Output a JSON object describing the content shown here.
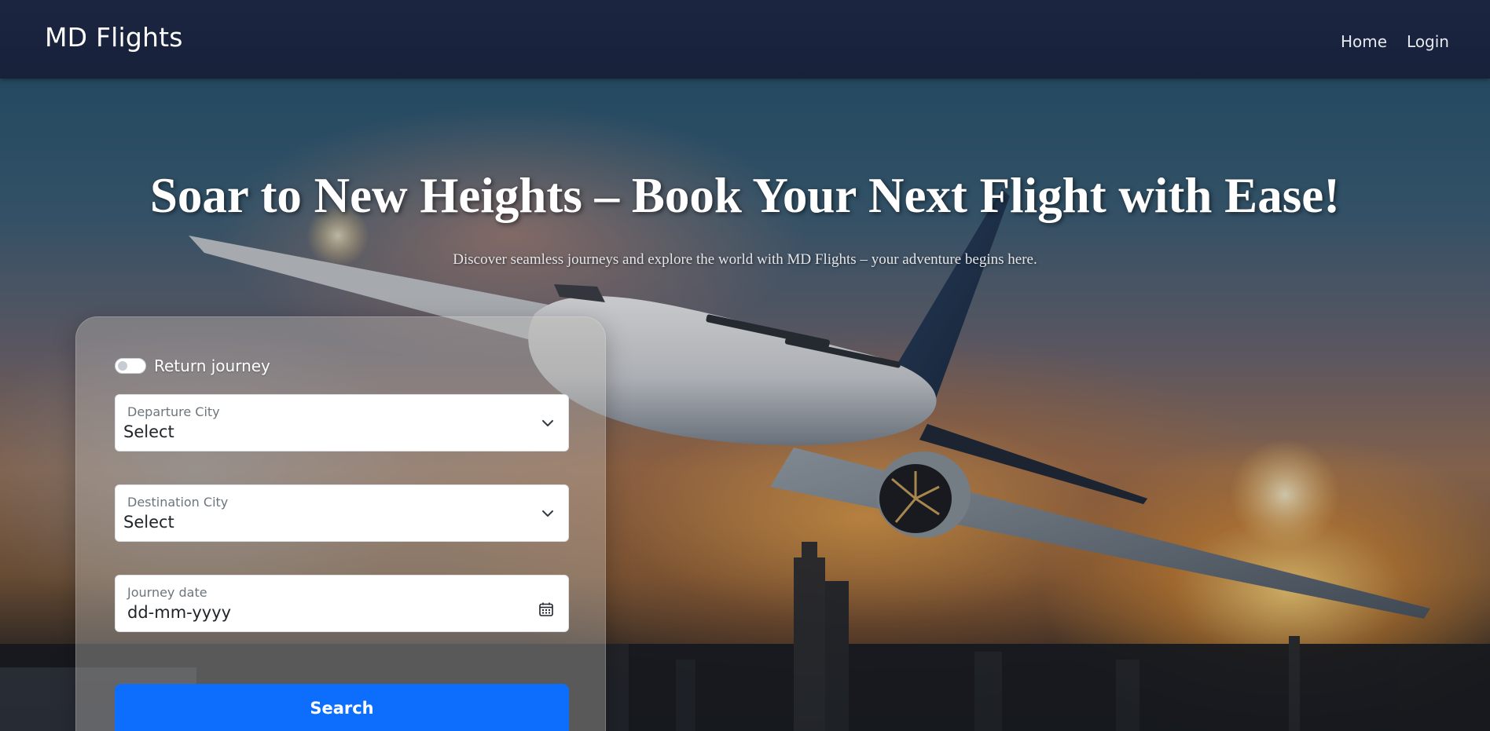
{
  "navbar": {
    "brand": "MD Flights",
    "links": [
      "Home",
      "Login"
    ]
  },
  "hero": {
    "title": "Soar to New Heights – Book Your Next Flight with Ease!",
    "subtitle": "Discover seamless journeys and explore the world with MD Flights – your adventure begins here."
  },
  "search_form": {
    "return_toggle": {
      "label": "Return journey",
      "checked": false
    },
    "departure": {
      "label": "Departure City",
      "value": "Select"
    },
    "destination": {
      "label": "Destination City",
      "value": "Select"
    },
    "journey_date": {
      "label": "Journey date",
      "value": "dd-mm-yyyy"
    },
    "search_button": "Search"
  },
  "colors": {
    "navbar_bg": "#1b2540",
    "primary_button": "#0d6efd",
    "text_white": "#ffffff"
  },
  "icons": [
    "chevron-down-icon",
    "calendar-icon"
  ]
}
